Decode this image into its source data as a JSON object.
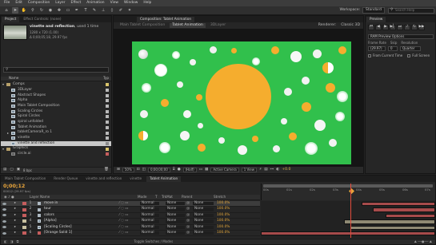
{
  "menu": [
    "File",
    "Edit",
    "Composition",
    "Layer",
    "Effect",
    "Animation",
    "View",
    "Window",
    "Help"
  ],
  "workspace": {
    "label": "Workspace:",
    "value": "Standard"
  },
  "search_placeholder": "Search Help",
  "project": {
    "tabs": [
      "Project",
      "Effect Controls: (none)"
    ],
    "selected_name": "vinette and reflection",
    "used_count": ", used 1 time",
    "info_line1": "1280 x 720 (1.00)",
    "info_line2": "Δ 0;00;05;18, 29.97 fps",
    "search_placeholder": "",
    "column_name": "Name",
    "column_type": "Typ",
    "items": [
      {
        "name": "Comps",
        "kind": "folder",
        "label_color": "#d8c36a"
      },
      {
        "name": "3DLayer",
        "kind": "comp",
        "label_color": "#b9b9b9"
      },
      {
        "name": "Abstract Shapes",
        "kind": "comp",
        "label_color": "#b9b9b9"
      },
      {
        "name": "Alpha",
        "kind": "comp",
        "label_color": "#b9b9b9"
      },
      {
        "name": "Main Tablet Composition",
        "kind": "comp",
        "label_color": "#b9b9b9"
      },
      {
        "name": "Scaling Circles",
        "kind": "comp",
        "label_color": "#b9b9b9"
      },
      {
        "name": "Spiral Circles",
        "kind": "comp",
        "label_color": "#b9b9b9"
      },
      {
        "name": "spiral unfolded",
        "kind": "comp",
        "label_color": "#b9b9b9"
      },
      {
        "name": "Tablet Animation",
        "kind": "comp",
        "label_color": "#b9b9b9"
      },
      {
        "name": "tabletCameraR_ro 1",
        "kind": "comp",
        "label_color": "#b9b9b9"
      },
      {
        "name": "vinette",
        "kind": "comp",
        "label_color": "#b9b9b9"
      },
      {
        "name": "vinette and reflection",
        "kind": "comp",
        "label_color": "#b9b9b9"
      },
      {
        "name": "Graphics",
        "kind": "folder",
        "label_color": "#d8c36a"
      },
      {
        "name": "circle.ai",
        "kind": "data",
        "label_color": "#c65d5d"
      }
    ],
    "bpc": "8 bpc"
  },
  "composition": {
    "title": "Composition: Tablet Animation",
    "tabs": [
      "Main Tablet Composition",
      "Tablet Animation",
      "3DLayer"
    ],
    "renderer_label": "Renderer:",
    "renderer_value": "Classic 3D",
    "zoom": "50%",
    "timecode": "0;00;00;00",
    "resolution": "(Half)",
    "camera": "Active Camera",
    "views": "1 View",
    "exposure": "+0.0",
    "bg_color": "#33c14d",
    "sun_color": "#f5ad2e"
  },
  "preview": {
    "tab": "Preview",
    "ram_options": "RAM Preview Options",
    "frame_rate_label": "Frame Rate",
    "skip_label": "Skip",
    "resolution_label": "Resolution",
    "frame_rate": "(29.97)",
    "skip": "0",
    "resolution": "Quarter",
    "from_current": "From Current Time",
    "full_screen": "Full Screen"
  },
  "timeline": {
    "tabs": [
      "Main Tablet Composition",
      "Render Queue",
      "vinette and reflection",
      "vinette",
      "Tablet Animation"
    ],
    "timecode": "0;00;12",
    "timecode_sub": "00012 (29.97 fps)",
    "col_layer_name": "Layer Name",
    "col_mode": "Mode",
    "col_t": "T",
    "col_trkmat": "TrkMat",
    "col_parent": "Parent",
    "col_stretch": "Stretch",
    "ruler": [
      "00s",
      "01s",
      "02s",
      "03s",
      "04s",
      "05s",
      "06s",
      "07s"
    ],
    "layers": [
      {
        "index": "1",
        "name": "move in",
        "label": "#c65d5d",
        "mode": "Normal",
        "trkmat": "None",
        "parent": "None",
        "stretch": "100.0%",
        "bracket": false
      },
      {
        "index": "2",
        "name": "tour",
        "label": "#c65d5d",
        "mode": "Normal",
        "trkmat": "None",
        "parent": "None",
        "stretch": "100.0%",
        "bracket": false
      },
      {
        "index": "3",
        "name": "colors",
        "label": "#c65d5d",
        "mode": "Normal",
        "trkmat": "None",
        "parent": "None",
        "stretch": "100.0%",
        "bracket": false
      },
      {
        "index": "4",
        "name": "[Alpha]",
        "label": "#c8c0a0",
        "mode": "Normal",
        "trkmat": "None",
        "parent": "None",
        "stretch": "100.0%",
        "bracket": true
      },
      {
        "index": "5",
        "name": "[Scaling Circles]",
        "label": "#c8c0a0",
        "mode": "Normal",
        "trkmat": "None",
        "parent": "None",
        "stretch": "100.0%",
        "bracket": true
      },
      {
        "index": "6",
        "name": "[Orange Solid 1]",
        "label": "#c65d5d",
        "mode": "Normal",
        "trkmat": "None",
        "parent": "None",
        "stretch": "100.0%",
        "bracket": true
      }
    ],
    "toggle_label": "Toggle Switches / Modes"
  }
}
